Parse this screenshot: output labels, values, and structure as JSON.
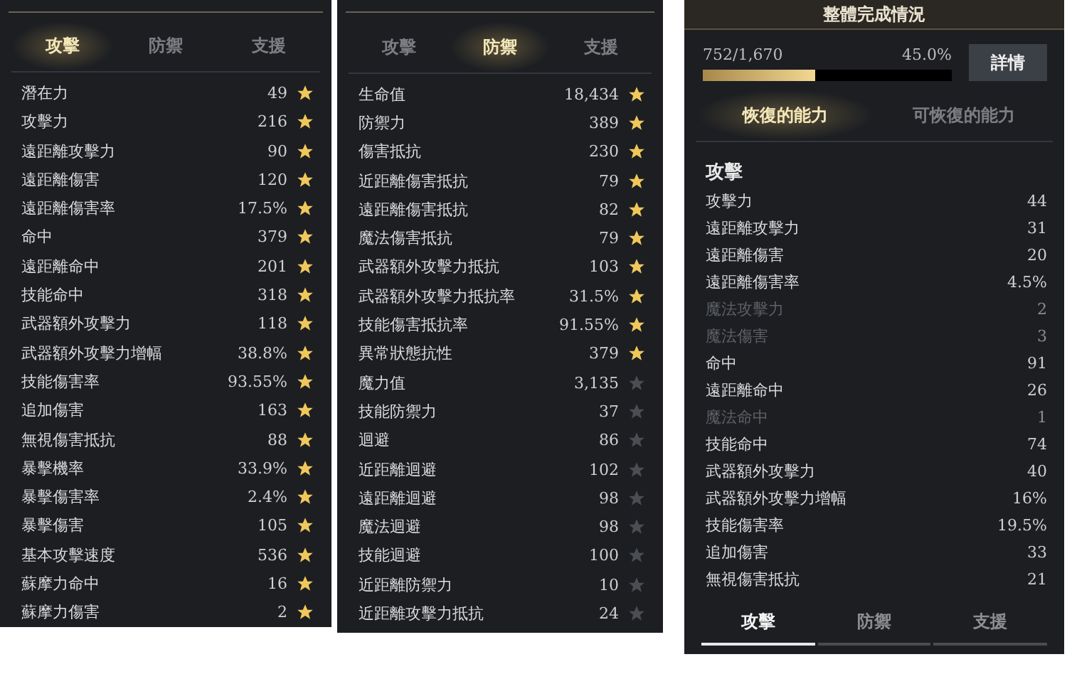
{
  "panels": [
    {
      "tabs": [
        {
          "label": "攻擊",
          "selected": true
        },
        {
          "label": "防禦",
          "selected": false
        },
        {
          "label": "支援",
          "selected": false
        }
      ],
      "rows": [
        {
          "name": "潛在力",
          "value": "49",
          "starred": true
        },
        {
          "name": "攻擊力",
          "value": "216",
          "starred": true
        },
        {
          "name": "遠距離攻擊力",
          "value": "90",
          "starred": true
        },
        {
          "name": "遠距離傷害",
          "value": "120",
          "starred": true
        },
        {
          "name": "遠距離傷害率",
          "value": "17.5%",
          "starred": true
        },
        {
          "name": "命中",
          "value": "379",
          "starred": true
        },
        {
          "name": "遠距離命中",
          "value": "201",
          "starred": true
        },
        {
          "name": "技能命中",
          "value": "318",
          "starred": true
        },
        {
          "name": "武器額外攻擊力",
          "value": "118",
          "starred": true
        },
        {
          "name": "武器額外攻擊力增幅",
          "value": "38.8%",
          "starred": true
        },
        {
          "name": "技能傷害率",
          "value": "93.55%",
          "starred": true
        },
        {
          "name": "追加傷害",
          "value": "163",
          "starred": true
        },
        {
          "name": "無視傷害抵抗",
          "value": "88",
          "starred": true
        },
        {
          "name": "暴擊機率",
          "value": "33.9%",
          "starred": true
        },
        {
          "name": "暴擊傷害率",
          "value": "2.4%",
          "starred": true
        },
        {
          "name": "暴擊傷害",
          "value": "105",
          "starred": true
        },
        {
          "name": "基本攻擊速度",
          "value": "536",
          "starred": true
        },
        {
          "name": "蘇摩力命中",
          "value": "16",
          "starred": true
        },
        {
          "name": "蘇摩力傷害",
          "value": "2",
          "starred": true
        }
      ]
    },
    {
      "tabs": [
        {
          "label": "攻擊",
          "selected": false
        },
        {
          "label": "防禦",
          "selected": true
        },
        {
          "label": "支援",
          "selected": false
        }
      ],
      "rows": [
        {
          "name": "生命值",
          "value": "18,434",
          "starred": true
        },
        {
          "name": "防禦力",
          "value": "389",
          "starred": true
        },
        {
          "name": "傷害抵抗",
          "value": "230",
          "starred": true
        },
        {
          "name": "近距離傷害抵抗",
          "value": "79",
          "starred": true
        },
        {
          "name": "遠距離傷害抵抗",
          "value": "82",
          "starred": true
        },
        {
          "name": "魔法傷害抵抗",
          "value": "79",
          "starred": true
        },
        {
          "name": "武器額外攻擊力抵抗",
          "value": "103",
          "starred": true
        },
        {
          "name": "武器額外攻擊力抵抗率",
          "value": "31.5%",
          "starred": true
        },
        {
          "name": "技能傷害抵抗率",
          "value": "91.55%",
          "starred": true
        },
        {
          "name": "異常狀態抗性",
          "value": "379",
          "starred": true
        },
        {
          "name": "魔力值",
          "value": "3,135",
          "starred": false
        },
        {
          "name": "技能防禦力",
          "value": "37",
          "starred": false
        },
        {
          "name": "迴避",
          "value": "86",
          "starred": false
        },
        {
          "name": "近距離迴避",
          "value": "102",
          "starred": false
        },
        {
          "name": "遠距離迴避",
          "value": "98",
          "starred": false
        },
        {
          "name": "魔法迴避",
          "value": "98",
          "starred": false
        },
        {
          "name": "技能迴避",
          "value": "100",
          "starred": false
        },
        {
          "name": "近距離防禦力",
          "value": "10",
          "starred": false
        },
        {
          "name": "近距離攻擊力抵抗",
          "value": "24",
          "starred": false
        }
      ]
    }
  ],
  "summary": {
    "title": "整體完成情況",
    "progress": "752/1,670",
    "percent": "45.0%",
    "level": 0.45,
    "details_button": "詳情",
    "tabs": [
      {
        "label": "恢復的能力",
        "selected": true
      },
      {
        "label": "可恢復的能力",
        "selected": false
      }
    ],
    "section": "攻擊",
    "rows": [
      {
        "name": "攻擊力",
        "value": "44",
        "dim": false
      },
      {
        "name": "遠距離攻擊力",
        "value": "31",
        "dim": false
      },
      {
        "name": "遠距離傷害",
        "value": "20",
        "dim": false
      },
      {
        "name": "遠距離傷害率",
        "value": "4.5%",
        "dim": false
      },
      {
        "name": "魔法攻擊力",
        "value": "2",
        "dim": true
      },
      {
        "name": "魔法傷害",
        "value": "3",
        "dim": true
      },
      {
        "name": "命中",
        "value": "91",
        "dim": false
      },
      {
        "name": "遠距離命中",
        "value": "26",
        "dim": false
      },
      {
        "name": "魔法命中",
        "value": "1",
        "dim": true
      },
      {
        "name": "技能命中",
        "value": "74",
        "dim": false
      },
      {
        "name": "武器額外攻擊力",
        "value": "40",
        "dim": false
      },
      {
        "name": "武器額外攻擊力增幅",
        "value": "16%",
        "dim": false
      },
      {
        "name": "技能傷害率",
        "value": "19.5%",
        "dim": false
      },
      {
        "name": "追加傷害",
        "value": "33",
        "dim": false
      },
      {
        "name": "無視傷害抵抗",
        "value": "21",
        "dim": false
      }
    ],
    "bottom_tabs": [
      {
        "label": "攻擊",
        "selected": true
      },
      {
        "label": "防禦",
        "selected": false
      },
      {
        "label": "支援",
        "selected": false
      }
    ]
  }
}
